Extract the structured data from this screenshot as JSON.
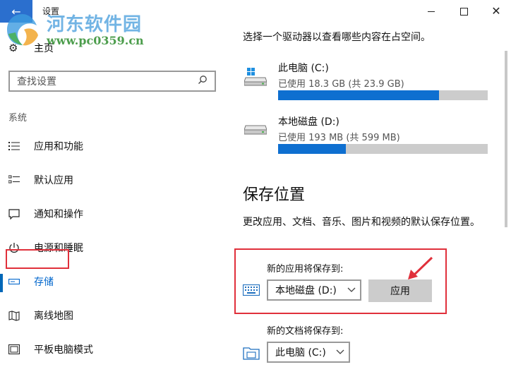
{
  "window": {
    "title": "设置",
    "back_icon": "arrow-left-icon",
    "accent": "#2b6fce"
  },
  "watermark": {
    "text": "河东软件园",
    "url": "www.pc0359.cn"
  },
  "sidebar": {
    "home_label": "主页",
    "search_placeholder": "查找设置",
    "section_label": "系统",
    "items": [
      {
        "label": "应用和功能",
        "icon": "apps-list-icon"
      },
      {
        "label": "默认应用",
        "icon": "default-apps-icon"
      },
      {
        "label": "通知和操作",
        "icon": "notification-icon"
      },
      {
        "label": "电源和睡眠",
        "icon": "power-icon"
      },
      {
        "label": "存储",
        "icon": "storage-icon",
        "active": true
      },
      {
        "label": "离线地图",
        "icon": "map-icon"
      },
      {
        "label": "平板电脑模式",
        "icon": "tablet-icon"
      }
    ]
  },
  "main": {
    "intro": "选择一个驱动器以查看哪些内容在占空间。",
    "drives": [
      {
        "name": "此电脑 (C:)",
        "usage": "已使用 18.3 GB (共 23.9 GB)",
        "fraction": 0.766
      },
      {
        "name": "本地磁盘 (D:)",
        "usage": "已使用 193 MB (共 599 MB)",
        "fraction": 0.322
      }
    ],
    "save_heading": "保存位置",
    "save_desc": "更改应用、文档、音乐、图片和视频的默认保存位置。",
    "apps_label": "新的应用将保存到:",
    "apps_value": "本地磁盘 (D:)",
    "apply_label": "应用",
    "docs_label": "新的文档将保存到:",
    "docs_value": "此电脑 (C:)"
  },
  "colors": {
    "bar_fill": "#0e6fd0",
    "bar_track": "#cccccc",
    "highlight": "#e0303b"
  }
}
